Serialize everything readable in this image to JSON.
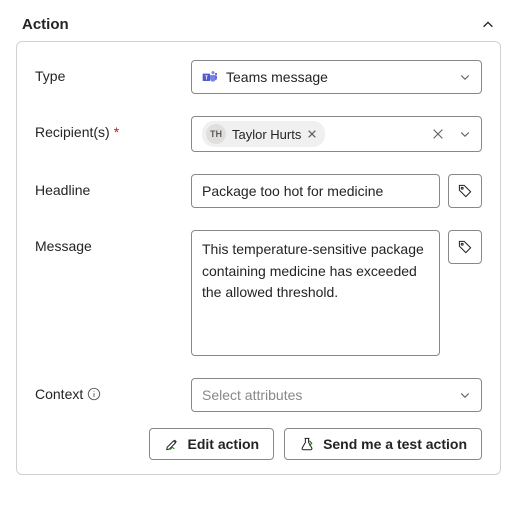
{
  "header": {
    "title": "Action"
  },
  "fields": {
    "type": {
      "label": "Type",
      "value": "Teams message"
    },
    "recipients": {
      "label": "Recipient(s)",
      "required_mark": "*",
      "chip": {
        "initials": "TH",
        "name": "Taylor Hurts"
      }
    },
    "headline": {
      "label": "Headline",
      "value": "Package too hot for medicine"
    },
    "message": {
      "label": "Message",
      "value": "This temperature-sensitive package containing medicine has exceeded the allowed threshold."
    },
    "context": {
      "label": "Context",
      "placeholder": "Select attributes"
    }
  },
  "footer": {
    "edit": "Edit action",
    "test": "Send me a test action"
  }
}
